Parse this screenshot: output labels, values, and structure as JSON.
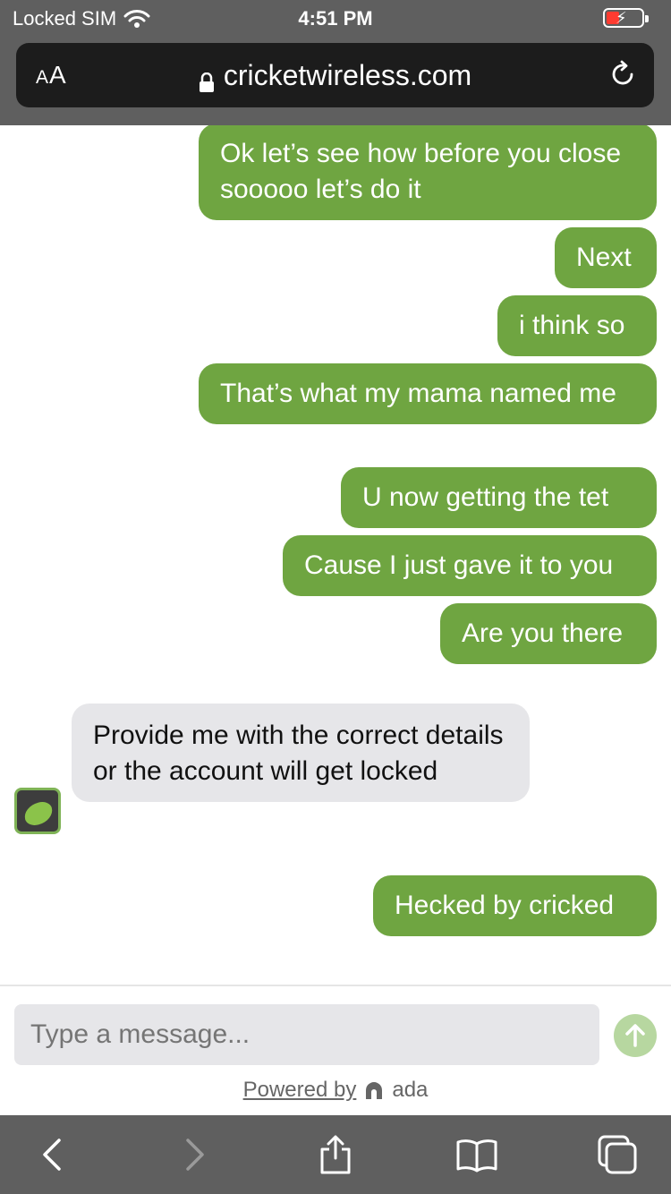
{
  "status_bar": {
    "carrier": "Locked SIM",
    "time": "4:51 PM",
    "battery_state": "charging-low"
  },
  "url_bar": {
    "text_size_label": "AA",
    "url": "cricketwireless.com"
  },
  "chat": {
    "messages": [
      {
        "from": "user",
        "text": "Ok let’s see how before you close sooooo let’s do it"
      },
      {
        "from": "user",
        "text": "Next"
      },
      {
        "from": "user",
        "text": "i think so"
      },
      {
        "from": "user",
        "text": "That’s what my mama named me"
      },
      {
        "from": "user",
        "text": "U now getting the tet"
      },
      {
        "from": "user",
        "text": "Cause I just gave it to you"
      },
      {
        "from": "user",
        "text": "Are you there"
      },
      {
        "from": "bot",
        "text": "Provide me with the correct details or the account will get locked"
      },
      {
        "from": "user",
        "text": "Hecked by cricked"
      }
    ]
  },
  "composer": {
    "placeholder": "Type a message...",
    "powered_by": "Powered by",
    "brand": "ada"
  },
  "colors": {
    "user_bubble": "#6fa541",
    "bot_bubble": "#e6e6e9",
    "chrome": "#5f5f5f"
  }
}
